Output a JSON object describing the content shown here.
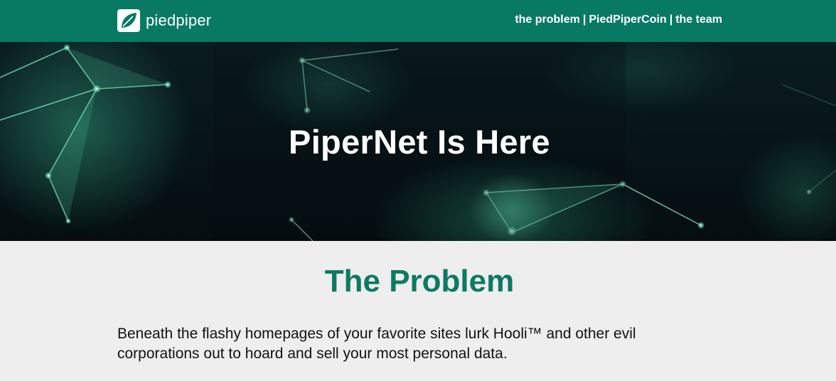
{
  "header": {
    "brand_name": "piedpiper",
    "brand_icon": "leaf-logo-icon",
    "nav": [
      {
        "label": "the problem"
      },
      {
        "label": "PiedPiperCoin"
      },
      {
        "label": "the team"
      }
    ],
    "nav_separator": "|"
  },
  "hero": {
    "title": "PiperNet Is Here"
  },
  "problem": {
    "title": "The Problem",
    "body": "Beneath the flashy homepages of your favorite sites lurk Hooli™ and other evil corporations out to hoard and sell your most personal data."
  },
  "colors": {
    "header_bg": "#087a64",
    "accent_green": "#0d7a62",
    "hero_bg": "#071215",
    "section_bg": "#eeeeee"
  }
}
